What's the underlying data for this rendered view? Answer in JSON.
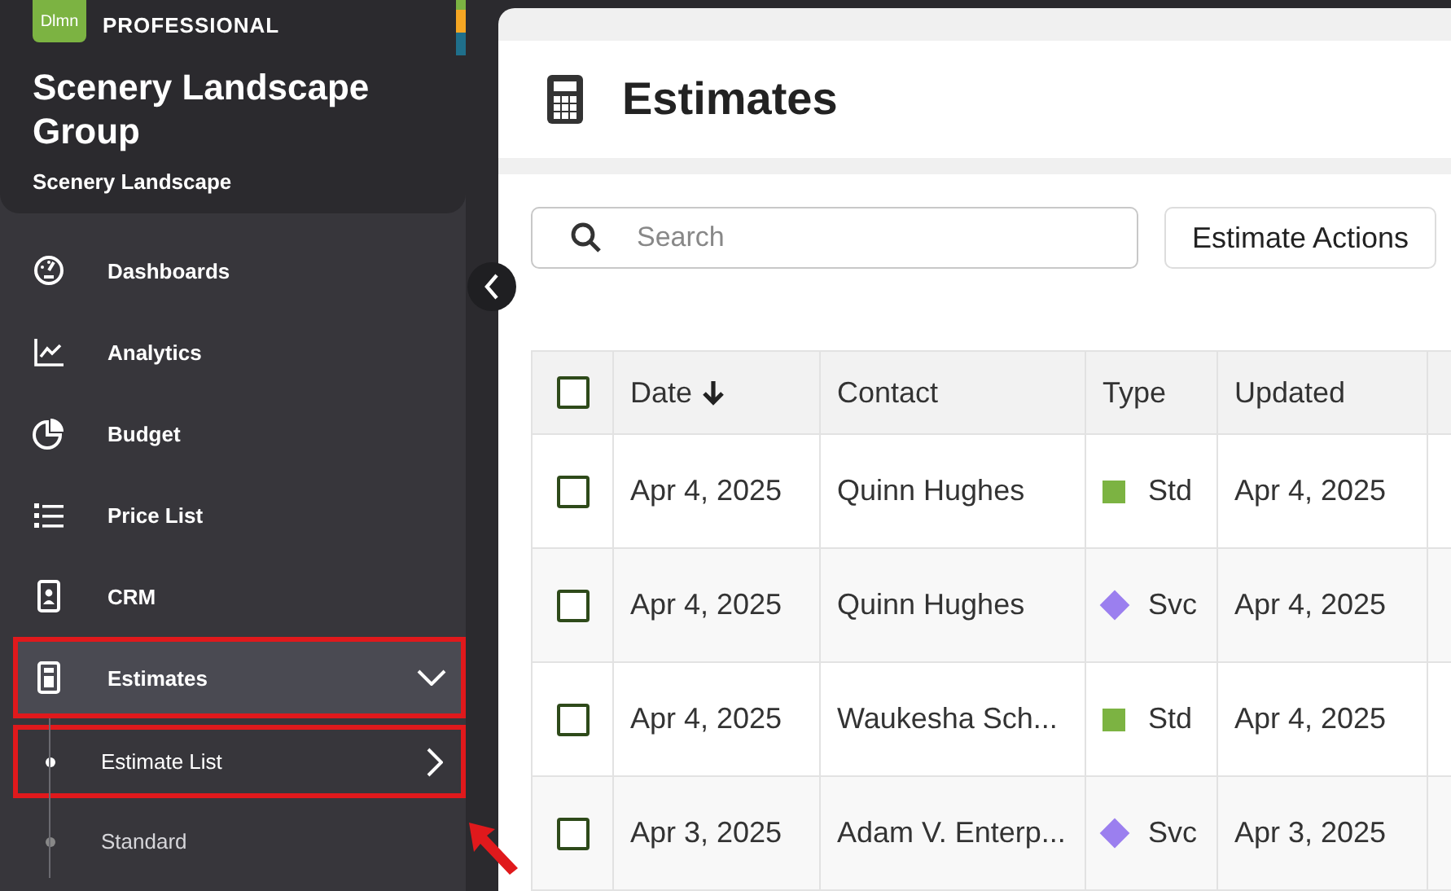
{
  "brand": {
    "logo": "Dlmn",
    "plan": "PROFESSIONAL",
    "company": "Scenery Landscape Group",
    "division": "Scenery Landscape"
  },
  "sidebar": {
    "items": [
      {
        "label": "Dashboards",
        "kind": "gauge",
        "selected": false,
        "highlighted": false
      },
      {
        "label": "Analytics",
        "kind": "chart",
        "selected": false,
        "highlighted": false
      },
      {
        "label": "Budget",
        "kind": "pie",
        "selected": false,
        "highlighted": false
      },
      {
        "label": "Price List",
        "kind": "list",
        "selected": false,
        "highlighted": false
      },
      {
        "label": "CRM",
        "kind": "badge",
        "selected": false,
        "highlighted": false
      },
      {
        "label": "Estimates",
        "kind": "calculator",
        "selected": true,
        "highlighted": true,
        "expanded": true,
        "children": [
          {
            "label": "Estimate List",
            "selected": true,
            "highlighted": true
          },
          {
            "label": "Standard",
            "selected": false,
            "highlighted": false
          }
        ]
      }
    ]
  },
  "page": {
    "title": "Estimates"
  },
  "toolbar": {
    "search": {
      "placeholder": "Search"
    },
    "actions_button": "Estimate Actions"
  },
  "table": {
    "all_checked": false,
    "columns": [
      {
        "label": "Date",
        "sorted": true
      },
      {
        "label": "Contact",
        "sorted": false
      },
      {
        "label": "Type",
        "sorted": false
      },
      {
        "label": "Updated",
        "sorted": false
      }
    ],
    "rows": [
      {
        "checked": false,
        "date": "Apr 4, 2025",
        "contact": "Quinn Hughes",
        "type": {
          "kind": "square",
          "label": "Std",
          "color": "#7cb342"
        },
        "updated": "Apr 4, 2025"
      },
      {
        "checked": false,
        "date": "Apr 4, 2025",
        "contact": "Quinn Hughes",
        "type": {
          "kind": "diamond",
          "label": "Svc",
          "color": "#9b7fef"
        },
        "updated": "Apr 4, 2025"
      },
      {
        "checked": false,
        "date": "Apr 4, 2025",
        "contact": "Waukesha Sch...",
        "type": {
          "kind": "square",
          "label": "Std",
          "color": "#7cb342"
        },
        "updated": "Apr 4, 2025"
      },
      {
        "checked": false,
        "date": "Apr 3, 2025",
        "contact": "Adam V. Enterp...",
        "type": {
          "kind": "diamond",
          "label": "Svc",
          "color": "#9b7fef"
        },
        "updated": "Apr 3, 2025"
      }
    ]
  }
}
